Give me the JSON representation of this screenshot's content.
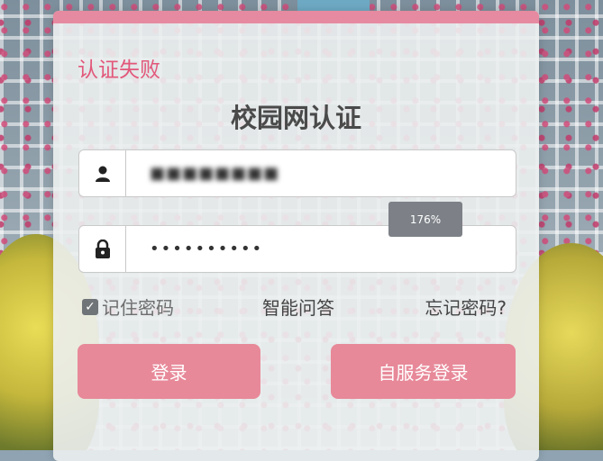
{
  "card": {
    "status_text": "认证失败",
    "title": "校园网认证"
  },
  "username": {
    "value": "■■■■■■■■",
    "icon": "user-icon"
  },
  "password": {
    "value": "••••••••••",
    "icon": "lock-icon"
  },
  "zoom": {
    "level": "176%"
  },
  "options": {
    "remember_label": "记住密码",
    "remember_checked": true,
    "qa_label": "智能问答",
    "forgot_label": "忘记密码?"
  },
  "buttons": {
    "login": "登录",
    "self_service": "自服务登录"
  },
  "colors": {
    "accent": "#e78999",
    "status": "#e2577a"
  }
}
